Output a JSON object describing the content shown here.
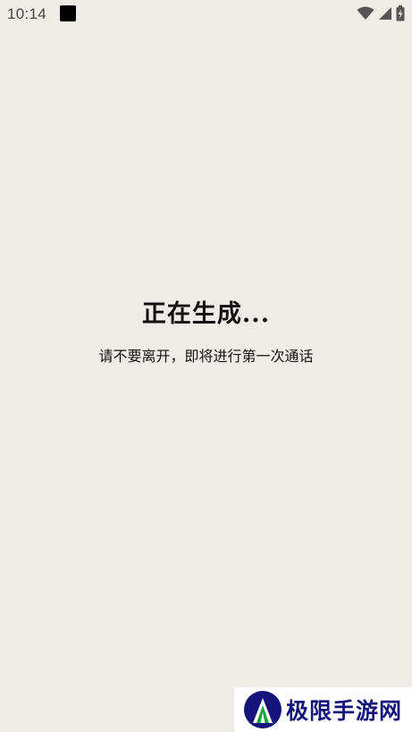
{
  "status_bar": {
    "time": "10:14",
    "icons": [
      "notification-square-icon",
      "wifi-icon",
      "cellular-signal-icon",
      "battery-charging-icon"
    ]
  },
  "main": {
    "title": "正在生成...",
    "subtitle": "请不要离开，即将进行第一次通话"
  },
  "watermark": {
    "text": "极限手游网",
    "colors": {
      "logo_blue": "#14147a",
      "logo_green": "#1aa33a"
    }
  },
  "colors": {
    "background": "#efebe7",
    "text": "#111111"
  }
}
